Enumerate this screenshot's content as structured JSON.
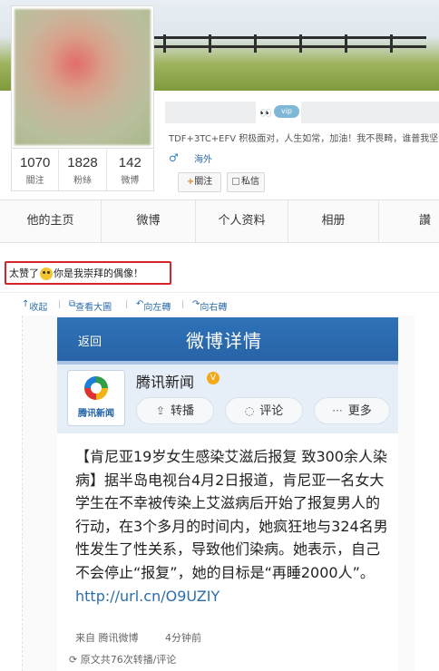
{
  "profile": {
    "stats": [
      {
        "value": "1070",
        "label": "關注"
      },
      {
        "value": "1828",
        "label": "粉絲"
      },
      {
        "value": "142",
        "label": "微博"
      }
    ],
    "vip_tag": "vip",
    "bio": "TDF+3TC+EFV 积极面对，人生如常，加油！我不畏畸，谁普我坚",
    "gender_symbol": "♂",
    "location": "海外",
    "follow_label": "關注",
    "message_label": "私信"
  },
  "tabs": [
    "他的主页",
    "微博",
    "个人资料",
    "相册",
    "讚"
  ],
  "comment": {
    "before": "太赞了",
    "after": "你是我崇拜的偶像！"
  },
  "image_toolbar": {
    "collapse": "收起",
    "view_large": "查看大圖",
    "rotate_left": "向左轉",
    "rotate_right": "向右轉"
  },
  "embedded": {
    "back": "返回",
    "title": "微博详情",
    "logo_text": "腾讯新闻",
    "source_name": "腾讯新闻",
    "actions": {
      "repost": "转播",
      "comment": "评论",
      "more": "更多"
    },
    "post_text": "【肯尼亚19岁女生感染艾滋后报复 致300余人染病】据半岛电视台4月2日报道，肯尼亚一名女大学生在不幸被传染上艾滋病后开始了报复男人的行动，在3个多月的时间内，她疯狂地与324名男性发生了性关系，导致他们染病。她表示，自己不会停止“报复”，她的目标是“再睡2000人”。",
    "post_link": "http://url.cn/O9UZIY",
    "from": "来自 腾讯微博",
    "time": "4分钟前",
    "repost_summary": "原文共76次转播/评论"
  }
}
